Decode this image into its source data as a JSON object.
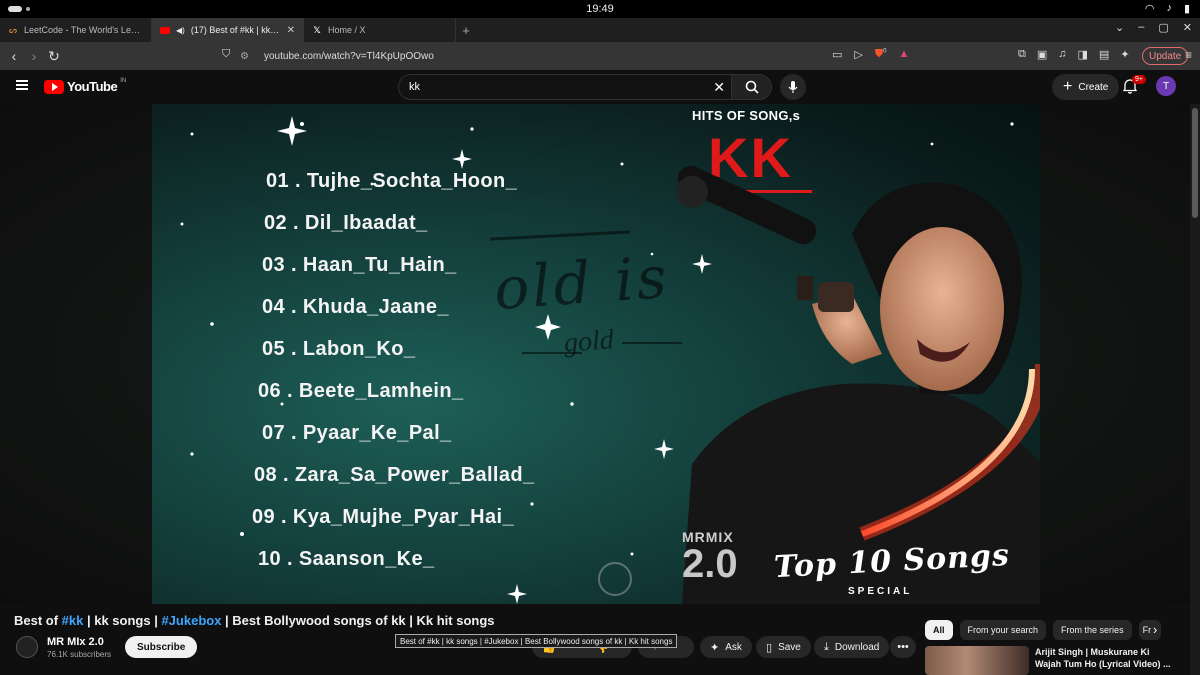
{
  "os": {
    "time": "19:49"
  },
  "browser": {
    "tabs": [
      {
        "title": "LeetCode - The World's Leading P",
        "icon": "leetcode-icon",
        "active": false
      },
      {
        "title": "(17) Best of #kk | kk songs",
        "icon": "youtube-icon",
        "active": true
      },
      {
        "title": "Home / X",
        "icon": "x-icon",
        "active": false
      }
    ],
    "url": "youtube.com/watch?v=Tl4KpUpOOwo",
    "update_label": "Update",
    "extension_badge": "0"
  },
  "youtube": {
    "country_code": "IN",
    "logo_text": "YouTube",
    "search_value": "kk",
    "create_label": "Create",
    "notification_count": "9+",
    "avatar_letter": "T"
  },
  "video_frame": {
    "hits_label": "HITS OF SONG,s",
    "artist": "KK",
    "songs": [
      "01 . Tujhe_Sochta_Hoon_",
      "02 . Dil_Ibaadat_",
      "03 . Haan_Tu_Hain_",
      "04 . Khuda_Jaane_",
      "05 . Labon_Ko_",
      "06 . Beete_Lamhein_",
      "07 . Pyaar_Ke_Pal_",
      "08 . Zara_Sa_Power_Ballad_",
      "09 . Kya_Mujhe_Pyar_Hai_",
      "10 . Saanson_Ke_"
    ],
    "overlay_main": "old is",
    "overlay_sub": "gold",
    "brand_top": "MRMIX",
    "brand_bottom": "2.0",
    "top10": "Top 10 Songs",
    "special": "SPECIAL"
  },
  "video_info": {
    "title_parts": [
      {
        "text": "Best of ",
        "tag": false
      },
      {
        "text": "#kk",
        "tag": true
      },
      {
        "text": " | kk songs | ",
        "tag": false
      },
      {
        "text": "#Jukebox",
        "tag": true
      },
      {
        "text": " | Best Bollywood songs of kk | Kk hit songs",
        "tag": false
      }
    ],
    "tooltip": "Best of #kk | kk songs | #Jukebox | Best Bollywood songs of kk | Kk hit songs",
    "channel_name": "MR MIx 2.0",
    "subscribers": "76.1K subscribers",
    "subscribe_label": "Subscribe",
    "ask_label": "Ask",
    "save_label": "Save",
    "download_label": "Download"
  },
  "sidebar": {
    "chips": [
      "All",
      "From your search",
      "From the series",
      "Fr"
    ],
    "recommendation_title": "Arijit Singh | Muskurane Ki Wajah Tum Ho (Lyrical Video) ..."
  },
  "colors": {
    "accent": "#ff0000",
    "link": "#3ea6ff",
    "kk_red": "#e01a1a",
    "avatar": "#6a3ab2"
  }
}
